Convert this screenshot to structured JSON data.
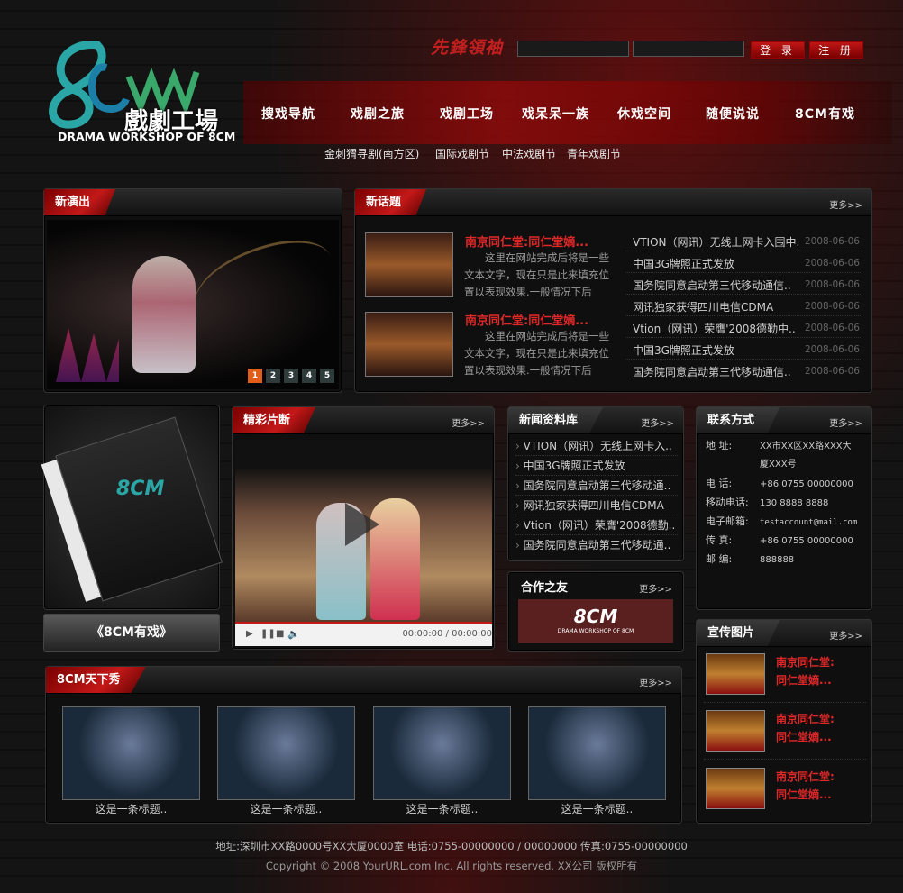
{
  "header": {
    "logo_text": "8CM",
    "logo_sub": "戲劇工場",
    "logo_caption": "DRAMA WORKSHOP OF 8CM",
    "lead_word": "先鋒領袖",
    "login": "登 录",
    "register": "注 册"
  },
  "nav": [
    "搜戏导航",
    "戏剧之旅",
    "戏剧工场",
    "戏呆呆一族",
    "休戏空间",
    "随便说说",
    "8CM有戏"
  ],
  "subnav": [
    "金刺猬寻剧(南方区)",
    "国际戏剧节",
    "中法戏剧节",
    "青年戏剧节"
  ],
  "new_show": {
    "title": "新演出",
    "pages": [
      "1",
      "2",
      "3",
      "4",
      "5"
    ],
    "active_page": 1
  },
  "new_topic": {
    "title": "新话题",
    "more": "更多>>",
    "features": [
      {
        "title": "南京同仁堂:同仁堂嫡...",
        "desc": "这里在网站完成后将是一些文本文字，现在只是此来填充位置以表现效果.一般情况下后"
      },
      {
        "title": "南京同仁堂:同仁堂嫡...",
        "desc": "这里在网站完成后将是一些文本文字，现在只是此来填充位置以表现效果.一般情况下后"
      }
    ],
    "items": [
      {
        "text": "VTION（网讯）无线上网卡入围中..",
        "date": "2008-06-06"
      },
      {
        "text": "中国3G牌照正式发放",
        "date": "2008-06-06"
      },
      {
        "text": "国务院同意启动第三代移动通信..",
        "date": "2008-06-06"
      },
      {
        "text": "网讯独家获得四川电信CDMA",
        "date": "2008-06-06"
      },
      {
        "text": "Vtion（网讯）荣膺'2008德勤中..",
        "date": "2008-06-06"
      },
      {
        "text": "中国3G牌照正式发放",
        "date": "2008-06-06"
      },
      {
        "text": "国务院同意启动第三代移动通信..",
        "date": "2008-06-06"
      }
    ]
  },
  "promo": {
    "button": "《8CM有戏》",
    "cd_text": "8CM"
  },
  "clips": {
    "title": "精彩片断",
    "more": "更多>>",
    "time": "00:00:00 / 00:00:00"
  },
  "news": {
    "title": "新闻资料库",
    "more": "更多>>",
    "items": [
      "VTION（网讯）无线上网卡入..",
      "中国3G牌照正式发放",
      "国务院同意启动第三代移动通..",
      "网讯独家获得四川电信CDMA",
      "Vtion（网讯）荣膺'2008德勤..",
      "国务院同意启动第三代移动通.."
    ]
  },
  "partners": {
    "title": "合作之友",
    "more": "更多>>",
    "logo_text": "8CM",
    "logo_caption": "DRAMA WORKSHOP OF 8CM"
  },
  "contact": {
    "title": "联系方式",
    "more": "更多>>",
    "rows": [
      {
        "k": "地    址:",
        "v": "XX市XX区XX路XXX大"
      },
      {
        "k": "",
        "v": "厦XXX号"
      },
      {
        "k": "电    话:",
        "v": "+86 0755 00000000"
      },
      {
        "k": "移动电话:",
        "v": "130 8888 8888"
      },
      {
        "k": "电子邮箱:",
        "v": "testaccount@mail.com"
      },
      {
        "k": "传    真:",
        "v": "+86 0755 00000000"
      },
      {
        "k": "邮    编:",
        "v": "888888"
      }
    ]
  },
  "photos": {
    "title": "宣传图片",
    "more": "更多>>",
    "items": [
      {
        "l1": "南京同仁堂:",
        "l2": "同仁堂嫡..."
      },
      {
        "l1": "南京同仁堂:",
        "l2": "同仁堂嫡..."
      },
      {
        "l1": "南京同仁堂:",
        "l2": "同仁堂嫡..."
      }
    ]
  },
  "showcase": {
    "title": "8CM天下秀",
    "more": "更多>>",
    "items": [
      "这是一条标题..",
      "这是一条标题..",
      "这是一条标题..",
      "这是一条标题.."
    ]
  },
  "footer": {
    "address": "地址:深圳市XX路0000号XX大厦0000室 电话:0755-00000000 / 00000000 传真:0755-00000000",
    "copyright": "Copyright © 2008 YourURL.com Inc. All rights reserved. XX公司 版权所有"
  },
  "colors": {
    "accent": "#c41818",
    "bg": "#101010",
    "pager_active": "#e25d17"
  }
}
